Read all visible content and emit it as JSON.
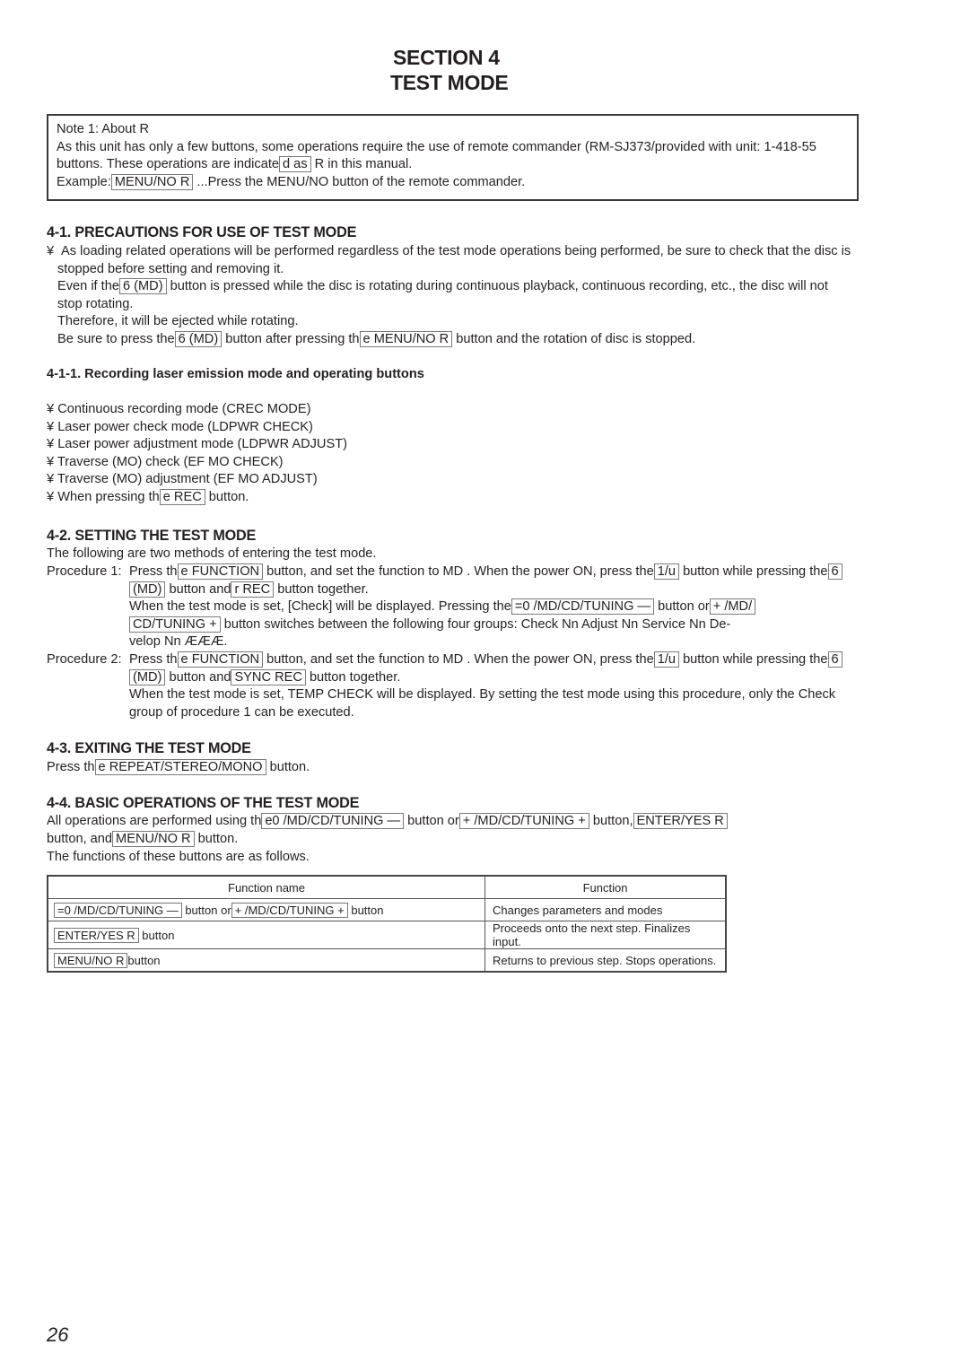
{
  "header": {
    "section": "SECTION  4",
    "title": "TEST MODE"
  },
  "note": {
    "title": "Note 1: About  R",
    "line1": "As this unit has only a few buttons, some operations require the use of remote commander (RM-SJ373/provided with unit: 1-418-55",
    "line2_pre": "buttons. These operations are indicate",
    "line2_box": "d as",
    "line2_post": "  R   in this manual.",
    "example_pre": "Example:",
    "example_box": " MENU/NO  R",
    "example_post": "  ...Press the MENU/NO button of the remote commander."
  },
  "s41": {
    "heading": "4-1. PRECAUTIONS FOR USE OF TEST MODE",
    "bullet": "¥",
    "p1": "As loading related operations will be performed regardless of the test mode operations being performed, be sure to check that the disc is",
    "p2": "stopped before setting and removing it.",
    "p3_pre": "Even if the",
    "p3_box": "6  (MD)",
    "p3_post": " button is pressed while the disc is rotating during continuous playback, continuous recording, etc., the disc will not",
    "p4": "stop rotating.",
    "p5": "Therefore, it will be ejected while rotating.",
    "p6_pre": "Be sure to press the",
    "p6_box1": "6  (MD)",
    "p6_mid": " button after pressing th",
    "p6_box2": "e  MENU/NO  R",
    "p6_post": "   button and the rotation of disc is stopped."
  },
  "s411": {
    "heading": "4-1-1. Recording laser emission mode and operating buttons",
    "items": [
      "Continuous recording mode (CREC MODE)",
      "Laser power check mode (LDPWR CHECK)",
      "Laser power adjustment mode (LDPWR ADJUST)",
      "Traverse (MO) check (EF MO CHECK)",
      "Traverse (MO) adjustment (EF MO ADJUST)"
    ],
    "last_pre": "When pressing th",
    "last_box": "e REC",
    "last_post": "  button."
  },
  "s42": {
    "heading": "4-2. SETTING THE TEST MODE",
    "intro": "The following are two methods of entering the test mode.",
    "proc1_label": "Procedure 1:",
    "proc1_l1_pre": "Press th",
    "proc1_l1_box": "e  FUNCTION",
    "proc1_l1_post": "  button, and set the function to  MD . When the power ON, press the",
    "proc1_l1_box2": "1/u",
    "proc1_l1_post2": " button while pressing the",
    "proc1_l1_box3": "6",
    "proc1_l2_box": "(MD)",
    "proc1_l2_mid": " button and",
    "proc1_l2_box2": "r   REC",
    "proc1_l2_post": "  button together.",
    "proc1_l3_pre": "When the test mode is set,  [Check]  will be displayed. Pressing the",
    "proc1_l3_box": "=0        /MD/CD/TUNING —",
    "proc1_l3_mid": "  button or",
    "proc1_l3_box2": "+           /MD/",
    "proc1_l4_box": "CD/TUNING +",
    "proc1_l4_post": " button switches between the following four groups: Check Nn    Adjust Nn    Service Nn    De-",
    "proc1_l5": "velop Nn     ÆÆÆ.",
    "proc2_label": "Procedure 2:",
    "proc2_l1_pre": "Press th",
    "proc2_l1_box": "e  FUNCTION",
    "proc2_l1_post": "  button, and set the function to  MD . When the power ON, press the",
    "proc2_l1_box2": "1/u",
    "proc2_l1_post2": " button while pressing the",
    "proc2_l1_box3": "6",
    "proc2_l2_box": "(MD)",
    "proc2_l2_mid": " button and",
    "proc2_l2_box2": " SYNC REC",
    "proc2_l2_post": "  button together.",
    "proc2_l3": "When the test mode is set,  TEMP CHECK  will be displayed. By setting the test mode using this procedure, only the  Check",
    "proc2_l4": "group of procedure 1 can be executed."
  },
  "s43": {
    "heading": "4-3. EXITING THE TEST MODE",
    "pre": "Press th",
    "box": "e  REPEAT/STEREO/MONO",
    "post": "  button."
  },
  "s44": {
    "heading": "4-4. BASIC OPERATIONS OF THE TEST MODE",
    "l1_pre": "All operations are performed using th",
    "l1_box1": "e0        /MD/CD/TUNING —",
    "l1_mid1": "  button or",
    "l1_box2": "+           /MD/CD/TUNING +",
    "l1_mid2": "  button,",
    "l1_box3": " ENTER/YES  R",
    "l2_pre": "button, and",
    "l2_box": " MENU/NO  R",
    "l2_post": "  button.",
    "l3": "The functions of these buttons are as follows."
  },
  "table": {
    "headers": [
      "Function name",
      "Function"
    ],
    "rows": [
      {
        "box1": "=0         /MD/CD/TUNING —",
        "mid": " button or",
        "box2": "+          /MD/CD/TUNING +",
        "post": " button",
        "function": "Changes parameters and modes"
      },
      {
        "box1": "ENTER/YES  R",
        "mid": " button",
        "box2": "",
        "post": "",
        "function": "Proceeds onto the next step. Finalizes input."
      },
      {
        "box1": "MENU/NO  R ",
        "mid": "button",
        "box2": "",
        "post": "",
        "function": "Returns to previous step. Stops operations."
      }
    ]
  },
  "footer": {
    "page_number": "26"
  }
}
